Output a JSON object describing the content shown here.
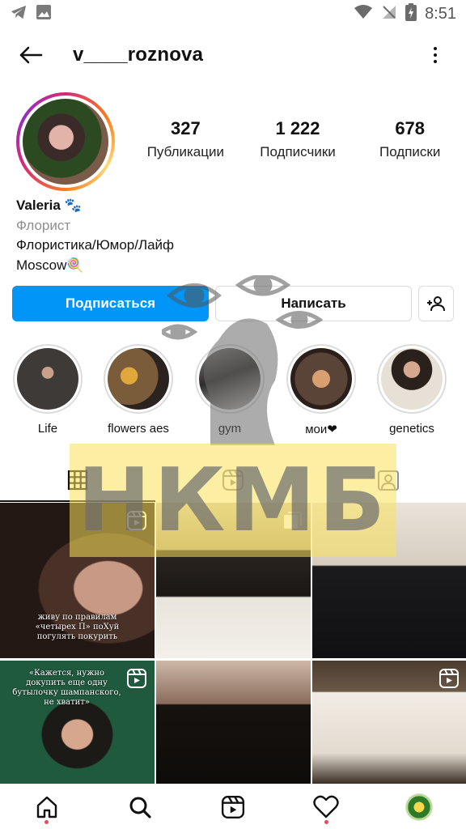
{
  "status_bar": {
    "time": "8:51"
  },
  "header": {
    "username": "v____roznova"
  },
  "profile": {
    "stats": [
      {
        "value": "327",
        "label": "Публикации"
      },
      {
        "value": "1 222",
        "label": "Подписчики"
      },
      {
        "value": "678",
        "label": "Подписки"
      }
    ],
    "name": "Valeria",
    "name_emoji": "🐾",
    "category": "Флорист",
    "bio_line1": "Флористика/Юмор/Лайф",
    "bio_line2": "Moscow",
    "bio_line2_emoji": "🍭"
  },
  "actions": {
    "follow_label": "Подписаться",
    "message_label": "Написать"
  },
  "highlights": [
    {
      "label": "Life",
      "color": "#3d3a38"
    },
    {
      "label": "flowers aes",
      "color": "#7a5b3a"
    },
    {
      "label": "gym",
      "color": "#2f2c2b"
    },
    {
      "label": "мои❤",
      "color": "#5a4438"
    },
    {
      "label": "genetics",
      "color": "#6d5646"
    }
  ],
  "tabs": [
    "grid",
    "reels",
    "tagged"
  ],
  "posts": [
    {
      "type": "reel",
      "caption": "живу по правилам «четырех П» поХуй погулять покурить"
    },
    {
      "type": "carousel",
      "caption": ""
    },
    {
      "type": "photo",
      "caption": ""
    },
    {
      "type": "reel",
      "caption": "«Кажется, нужно докупить еще одну бутылочку шампанского, не хватит»"
    },
    {
      "type": "photo",
      "caption": ""
    },
    {
      "type": "reel",
      "caption": ""
    }
  ],
  "watermark": {
    "text": "НКМБ"
  },
  "colors": {
    "accent": "#0095f6",
    "notification": "#ed4956"
  }
}
